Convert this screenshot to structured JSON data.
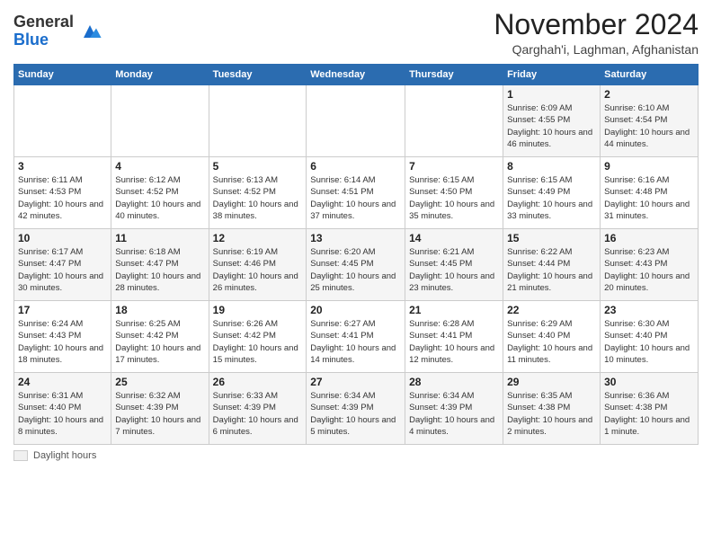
{
  "app": {
    "name_general": "General",
    "name_blue": "Blue"
  },
  "header": {
    "month": "November 2024",
    "location": "Qarghah'i, Laghman, Afghanistan"
  },
  "calendar": {
    "days_of_week": [
      "Sunday",
      "Monday",
      "Tuesday",
      "Wednesday",
      "Thursday",
      "Friday",
      "Saturday"
    ],
    "weeks": [
      [
        {
          "day": "",
          "info": ""
        },
        {
          "day": "",
          "info": ""
        },
        {
          "day": "",
          "info": ""
        },
        {
          "day": "",
          "info": ""
        },
        {
          "day": "",
          "info": ""
        },
        {
          "day": "1",
          "info": "Sunrise: 6:09 AM\nSunset: 4:55 PM\nDaylight: 10 hours and 46 minutes."
        },
        {
          "day": "2",
          "info": "Sunrise: 6:10 AM\nSunset: 4:54 PM\nDaylight: 10 hours and 44 minutes."
        }
      ],
      [
        {
          "day": "3",
          "info": "Sunrise: 6:11 AM\nSunset: 4:53 PM\nDaylight: 10 hours and 42 minutes."
        },
        {
          "day": "4",
          "info": "Sunrise: 6:12 AM\nSunset: 4:52 PM\nDaylight: 10 hours and 40 minutes."
        },
        {
          "day": "5",
          "info": "Sunrise: 6:13 AM\nSunset: 4:52 PM\nDaylight: 10 hours and 38 minutes."
        },
        {
          "day": "6",
          "info": "Sunrise: 6:14 AM\nSunset: 4:51 PM\nDaylight: 10 hours and 37 minutes."
        },
        {
          "day": "7",
          "info": "Sunrise: 6:15 AM\nSunset: 4:50 PM\nDaylight: 10 hours and 35 minutes."
        },
        {
          "day": "8",
          "info": "Sunrise: 6:15 AM\nSunset: 4:49 PM\nDaylight: 10 hours and 33 minutes."
        },
        {
          "day": "9",
          "info": "Sunrise: 6:16 AM\nSunset: 4:48 PM\nDaylight: 10 hours and 31 minutes."
        }
      ],
      [
        {
          "day": "10",
          "info": "Sunrise: 6:17 AM\nSunset: 4:47 PM\nDaylight: 10 hours and 30 minutes."
        },
        {
          "day": "11",
          "info": "Sunrise: 6:18 AM\nSunset: 4:47 PM\nDaylight: 10 hours and 28 minutes."
        },
        {
          "day": "12",
          "info": "Sunrise: 6:19 AM\nSunset: 4:46 PM\nDaylight: 10 hours and 26 minutes."
        },
        {
          "day": "13",
          "info": "Sunrise: 6:20 AM\nSunset: 4:45 PM\nDaylight: 10 hours and 25 minutes."
        },
        {
          "day": "14",
          "info": "Sunrise: 6:21 AM\nSunset: 4:45 PM\nDaylight: 10 hours and 23 minutes."
        },
        {
          "day": "15",
          "info": "Sunrise: 6:22 AM\nSunset: 4:44 PM\nDaylight: 10 hours and 21 minutes."
        },
        {
          "day": "16",
          "info": "Sunrise: 6:23 AM\nSunset: 4:43 PM\nDaylight: 10 hours and 20 minutes."
        }
      ],
      [
        {
          "day": "17",
          "info": "Sunrise: 6:24 AM\nSunset: 4:43 PM\nDaylight: 10 hours and 18 minutes."
        },
        {
          "day": "18",
          "info": "Sunrise: 6:25 AM\nSunset: 4:42 PM\nDaylight: 10 hours and 17 minutes."
        },
        {
          "day": "19",
          "info": "Sunrise: 6:26 AM\nSunset: 4:42 PM\nDaylight: 10 hours and 15 minutes."
        },
        {
          "day": "20",
          "info": "Sunrise: 6:27 AM\nSunset: 4:41 PM\nDaylight: 10 hours and 14 minutes."
        },
        {
          "day": "21",
          "info": "Sunrise: 6:28 AM\nSunset: 4:41 PM\nDaylight: 10 hours and 12 minutes."
        },
        {
          "day": "22",
          "info": "Sunrise: 6:29 AM\nSunset: 4:40 PM\nDaylight: 10 hours and 11 minutes."
        },
        {
          "day": "23",
          "info": "Sunrise: 6:30 AM\nSunset: 4:40 PM\nDaylight: 10 hours and 10 minutes."
        }
      ],
      [
        {
          "day": "24",
          "info": "Sunrise: 6:31 AM\nSunset: 4:40 PM\nDaylight: 10 hours and 8 minutes."
        },
        {
          "day": "25",
          "info": "Sunrise: 6:32 AM\nSunset: 4:39 PM\nDaylight: 10 hours and 7 minutes."
        },
        {
          "day": "26",
          "info": "Sunrise: 6:33 AM\nSunset: 4:39 PM\nDaylight: 10 hours and 6 minutes."
        },
        {
          "day": "27",
          "info": "Sunrise: 6:34 AM\nSunset: 4:39 PM\nDaylight: 10 hours and 5 minutes."
        },
        {
          "day": "28",
          "info": "Sunrise: 6:34 AM\nSunset: 4:39 PM\nDaylight: 10 hours and 4 minutes."
        },
        {
          "day": "29",
          "info": "Sunrise: 6:35 AM\nSunset: 4:38 PM\nDaylight: 10 hours and 2 minutes."
        },
        {
          "day": "30",
          "info": "Sunrise: 6:36 AM\nSunset: 4:38 PM\nDaylight: 10 hours and 1 minute."
        }
      ]
    ]
  },
  "legend": {
    "label": "Daylight hours"
  }
}
